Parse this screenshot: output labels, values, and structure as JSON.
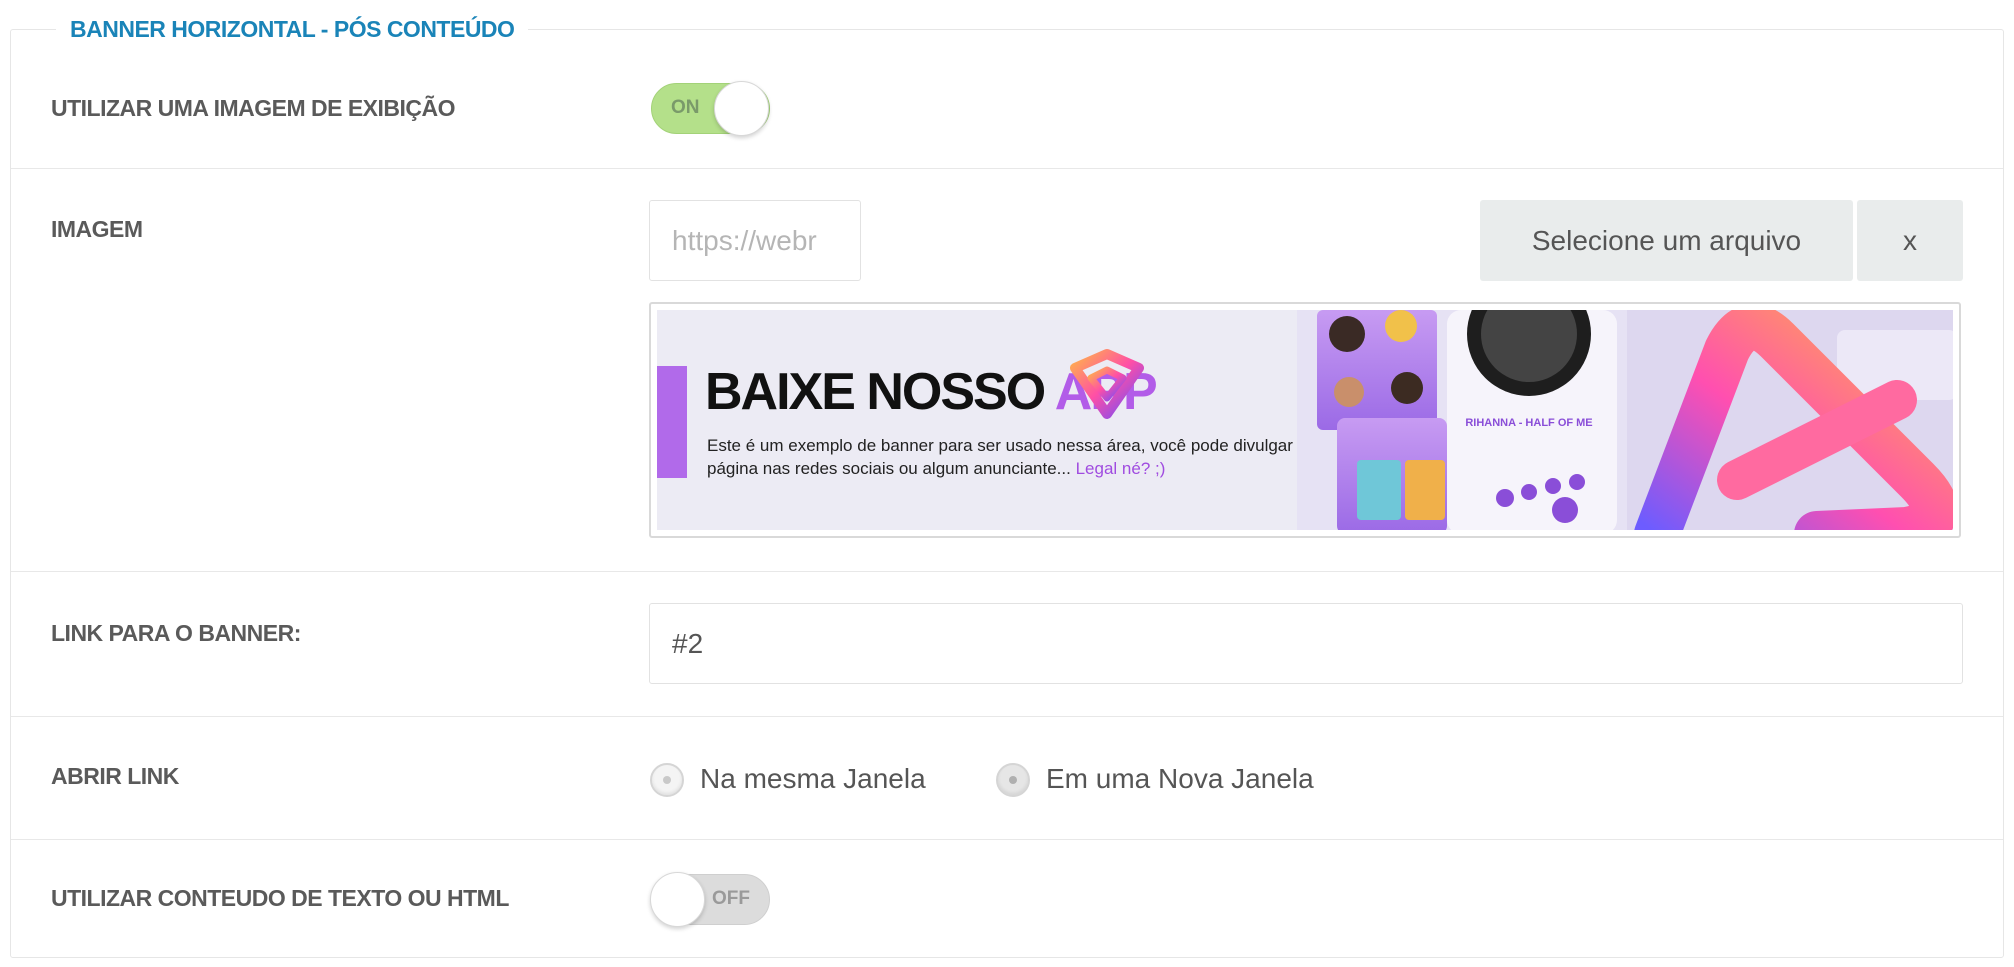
{
  "section_title": "BANNER HORIZONTAL - PÓS CONTEÚDO",
  "use_image": {
    "label": "UTILIZAR UMA IMAGEM DE EXIBIÇÃO",
    "toggle_text": "ON"
  },
  "image": {
    "label": "IMAGEM",
    "url_value": "https://webr",
    "select_button": "Selecione um arquivo",
    "clear_button": "x",
    "banner": {
      "headline": "BAIXE NOSSO",
      "headline_accent": "APP",
      "line1": "Este é um exemplo de banner para ser usado nessa área, você pode divulgar seus aplicativos,",
      "line2": "página nas redes sociais ou algum anunciante...",
      "line2_accent": "Legal né? ;)",
      "player_caption": "RIHANNA - HALF OF ME"
    }
  },
  "link": {
    "label": "LINK PARA O BANNER:",
    "value": "#2"
  },
  "open_link": {
    "label": "ABRIR LINK",
    "option_same": "Na mesma Janela",
    "option_new": "Em uma Nova Janela",
    "selected": "Em uma Nova Janela"
  },
  "use_html": {
    "label": "UTILIZAR CONTEUDO DE TEXTO OU HTML",
    "toggle_text": "OFF"
  },
  "colors": {
    "accent": "#1a84b8",
    "toggle_on": "#b4e08a",
    "banner_purple": "#b25ce8"
  }
}
